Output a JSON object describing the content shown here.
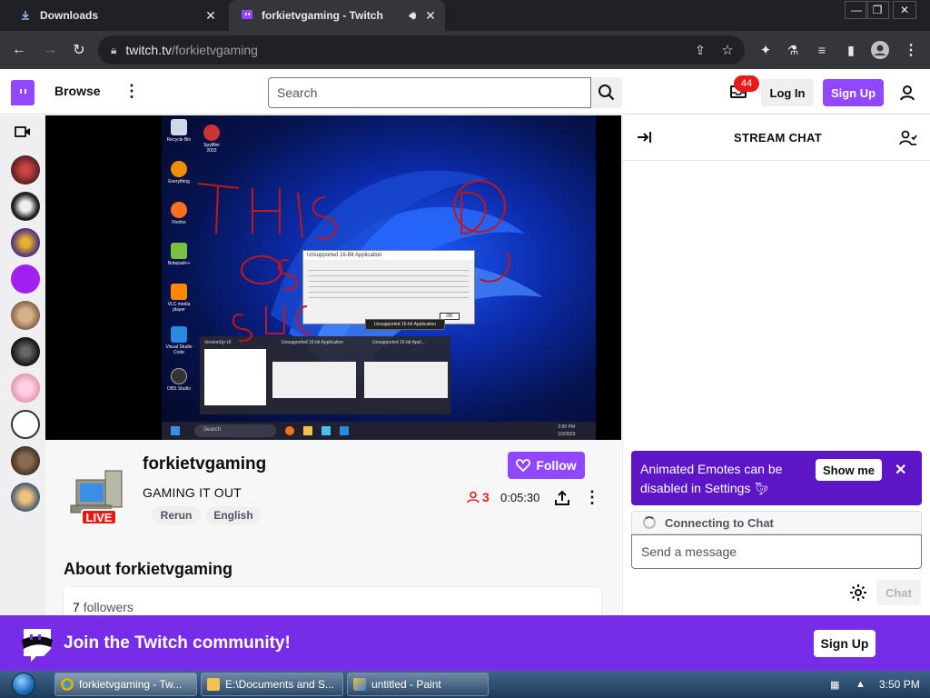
{
  "browser": {
    "tabs": [
      {
        "title": "Downloads",
        "icon": "download-icon",
        "active": false
      },
      {
        "title": "forkietvgaming - Twitch",
        "icon": "twitch-icon",
        "active": true,
        "audio": true
      }
    ],
    "url_domain": "twitch.tv",
    "url_path": "/forkietvgaming"
  },
  "twitch": {
    "browse_label": "Browse",
    "search_placeholder": "Search",
    "notification_count": "44",
    "login_label": "Log In",
    "signup_label": "Sign Up"
  },
  "video": {
    "desktop_icons": [
      "Recycle Bin",
      "Spyfiller 2003",
      "Everything",
      "Firefox",
      "Notepad++",
      "VLC media player",
      "Visual Studio Code",
      "OBS Studio"
    ],
    "dialog_title": "Unsupported 16-Bit Application",
    "dialog_ok": "OK",
    "tooltip": "Unsupported 16-bit Application",
    "thumbnails": [
      "VersionUp UI",
      "Unsupported 16-bit Application",
      "Unsupported 16-bit Appl..."
    ],
    "taskbar_search": "Search",
    "taskbar_time": "3:50 PM",
    "taskbar_date": "1/3/2023",
    "scribble": "THIS OS SUCKS"
  },
  "channel": {
    "name": "forkietvgaming",
    "title": "GAMING IT OUT",
    "live_label": "LIVE",
    "tags": [
      "Rerun",
      "English"
    ],
    "follow_label": "Follow",
    "viewers": "3",
    "uptime": "0:05:30",
    "about_heading": "About forkietvgaming",
    "followers_count": "7",
    "followers_label": "followers"
  },
  "chat": {
    "title": "STREAM CHAT",
    "promo_text": "Animated Emotes can be disabled in Settings",
    "show_me_label": "Show me",
    "connecting_label": "Connecting to Chat",
    "message_placeholder": "Send a message",
    "chat_button_label": "Chat"
  },
  "join_banner": {
    "text": "Join the Twitch community!",
    "signup_label": "Sign Up"
  },
  "windows_taskbar": {
    "items": [
      {
        "label": "forkietvgaming - Tw...",
        "icon": "chrome-icon"
      },
      {
        "label": "E:\\Documents and S...",
        "icon": "folder-icon"
      },
      {
        "label": "untitled - Paint",
        "icon": "paint-icon"
      }
    ],
    "clock": "3:50 PM"
  },
  "colors": {
    "twitch_purple": "#9147ff",
    "banner_purple": "#772ce8",
    "promo_purple": "#5c16c5",
    "live_red": "#e91916"
  }
}
